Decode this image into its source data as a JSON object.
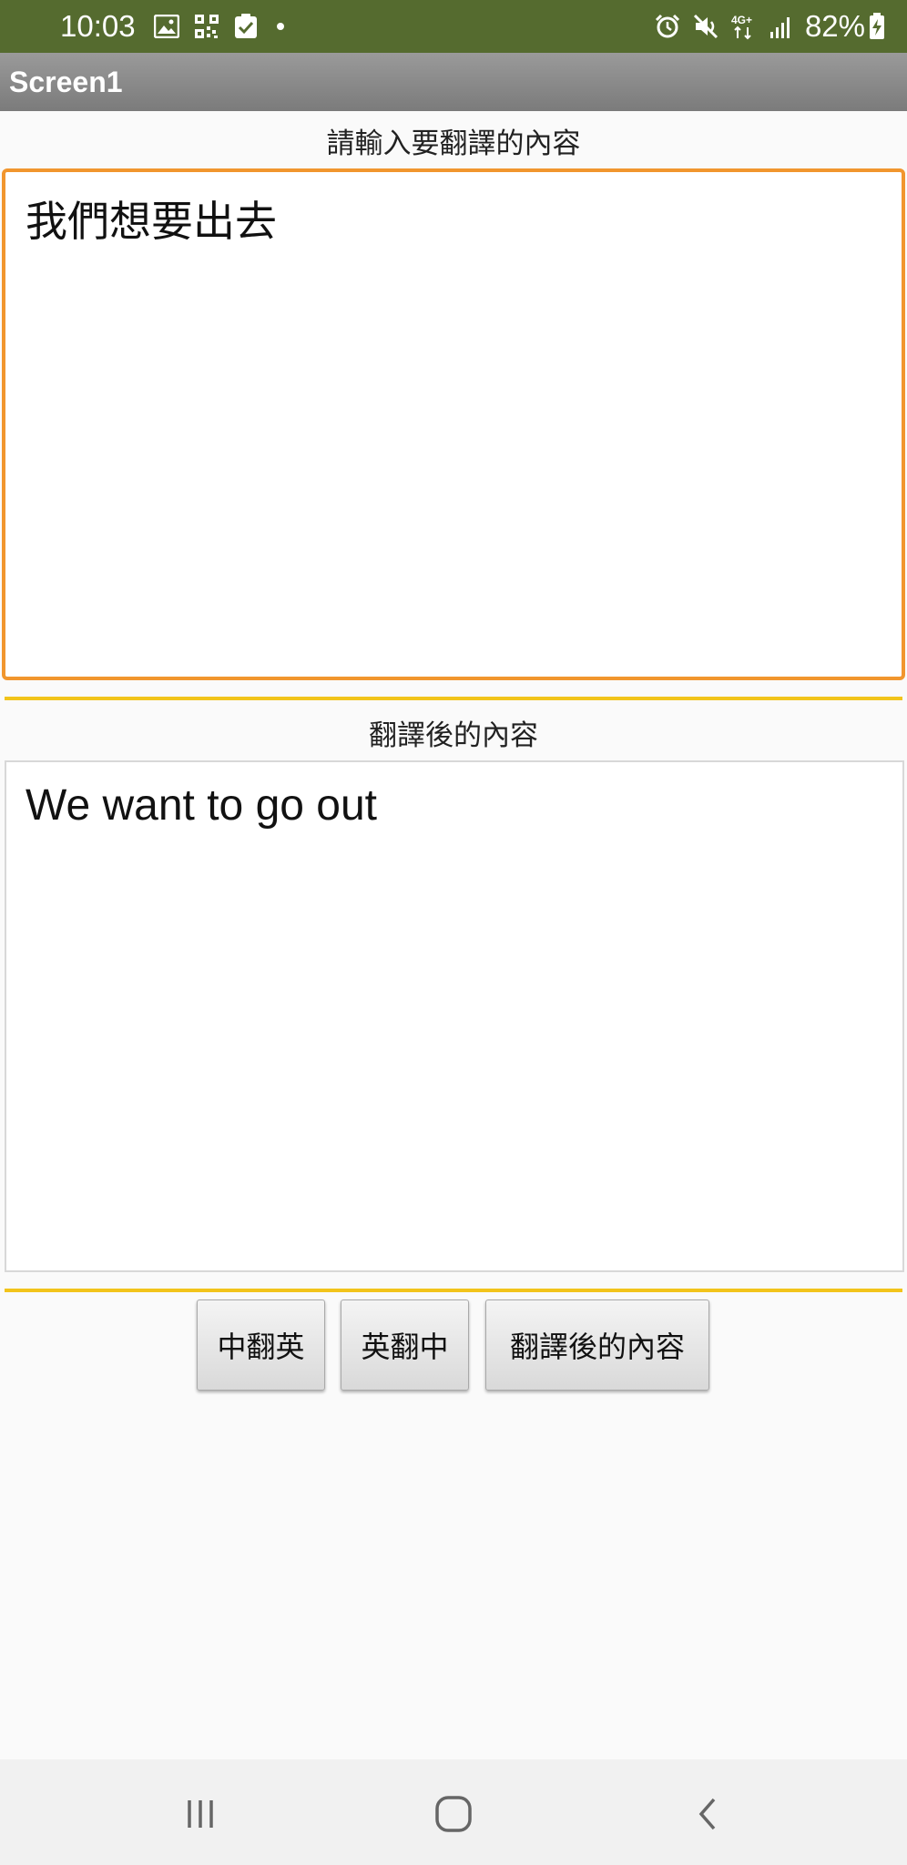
{
  "status_bar": {
    "time": "10:03",
    "battery": "82%",
    "network": "4G+",
    "bg_color": "#556b2f",
    "left_icons": [
      "image-icon",
      "qr-code-icon",
      "checkbox-icon",
      "dot-icon"
    ],
    "right_icons": [
      "alarm-icon",
      "mute-icon",
      "network-4g-icon",
      "signal-icon",
      "battery-charging-icon"
    ]
  },
  "title_bar": {
    "title": "Screen1"
  },
  "input_section": {
    "label": "請輸入要翻譯的內容",
    "value": "我們想要出去",
    "focus_color": "#f1962e"
  },
  "output_section": {
    "label": "翻譯後的內容",
    "value": "We want to go out"
  },
  "buttons": {
    "zh_to_en": "中翻英",
    "en_to_zh": "英翻中",
    "translated": "翻譯後的內容"
  },
  "divider_color": "#f2c41b",
  "nav_bar": {
    "icons": [
      "recent-apps-icon",
      "home-icon",
      "back-icon"
    ]
  }
}
